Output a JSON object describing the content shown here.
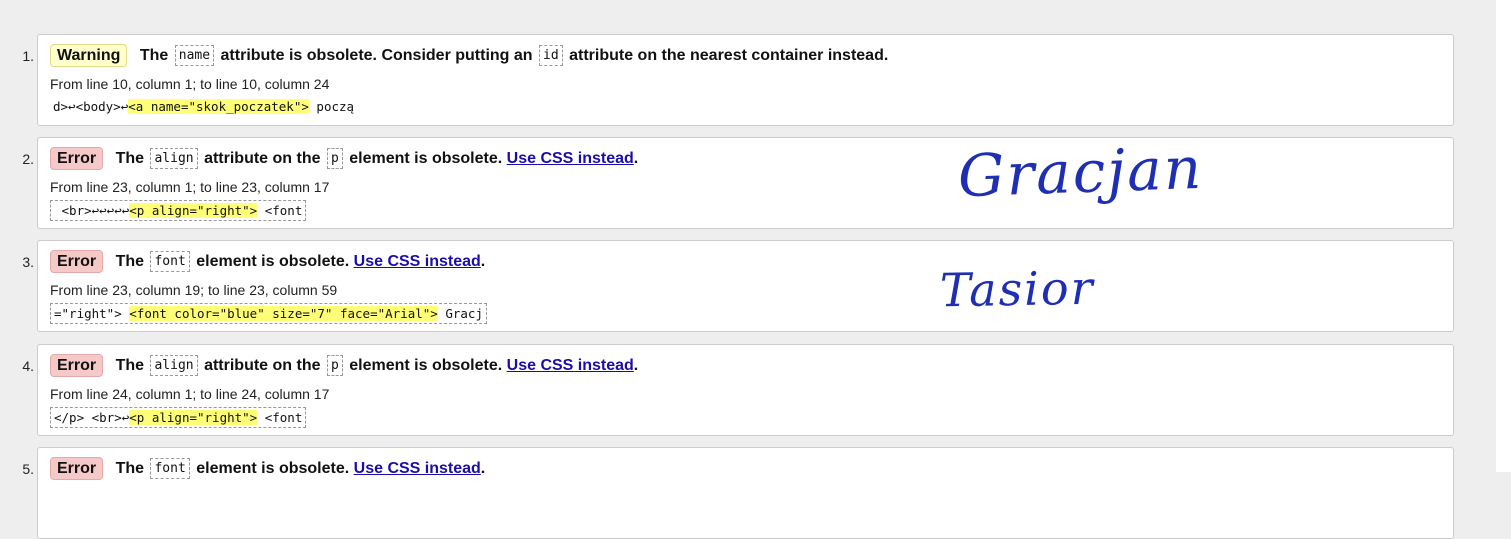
{
  "messages": [
    {
      "number": "1.",
      "type": "Warning",
      "parts": {
        "p1": "The",
        "code1": "name",
        "p2": "attribute is obsolete. Consider putting an",
        "code2": "id",
        "p3": "attribute on the nearest container instead."
      },
      "location": "From line 10, column 1; to line 10, column 24",
      "extract": {
        "before": "d>↩<body>↩",
        "highlight": "<a name=\"skok_poczatek\">",
        "after": " począ"
      }
    },
    {
      "number": "2.",
      "type": "Error",
      "parts": {
        "p1": "The",
        "code1": "align",
        "p2": "attribute on the",
        "code2": "p",
        "p3": "element is obsolete.",
        "link": "Use CSS instead",
        "tail": "."
      },
      "location": "From line 23, column 1; to line 23, column 17",
      "extract": {
        "before": " <br>↩↩↩↩↩",
        "highlight": "<p align=\"right\">",
        "after": " <font"
      }
    },
    {
      "number": "3.",
      "type": "Error",
      "parts": {
        "p1": "The",
        "code1": "font",
        "p2": "element is obsolete.",
        "link": "Use CSS instead",
        "tail": "."
      },
      "location": "From line 23, column 19; to line 23, column 59",
      "extract": {
        "before": "=\"right\"> ",
        "highlight": "<font color=\"blue\" size=\"7\" face=\"Arial\">",
        "after": " Gracj"
      }
    },
    {
      "number": "4.",
      "type": "Error",
      "parts": {
        "p1": "The",
        "code1": "align",
        "p2": "attribute on the",
        "code2": "p",
        "p3": "element is obsolete.",
        "link": "Use CSS instead",
        "tail": "."
      },
      "location": "From line 24, column 1; to line 24, column 17",
      "extract": {
        "before": "</p> <br>↩",
        "highlight": "<p align=\"right\">",
        "after": " <font"
      }
    },
    {
      "number": "5.",
      "type": "Error",
      "parts": {
        "p1": "The",
        "code1": "font",
        "p2": "element is obsolete.",
        "link": "Use CSS instead",
        "tail": "."
      }
    }
  ],
  "handwriting": {
    "line1": "Gracjan",
    "line2": "Tasior"
  },
  "colors": {
    "warning_bg": "#ffffcc",
    "error_bg": "#f6c9c9",
    "highlight": "#ffff77",
    "link": "#1a0dab",
    "ink": "#1f2fb3"
  }
}
